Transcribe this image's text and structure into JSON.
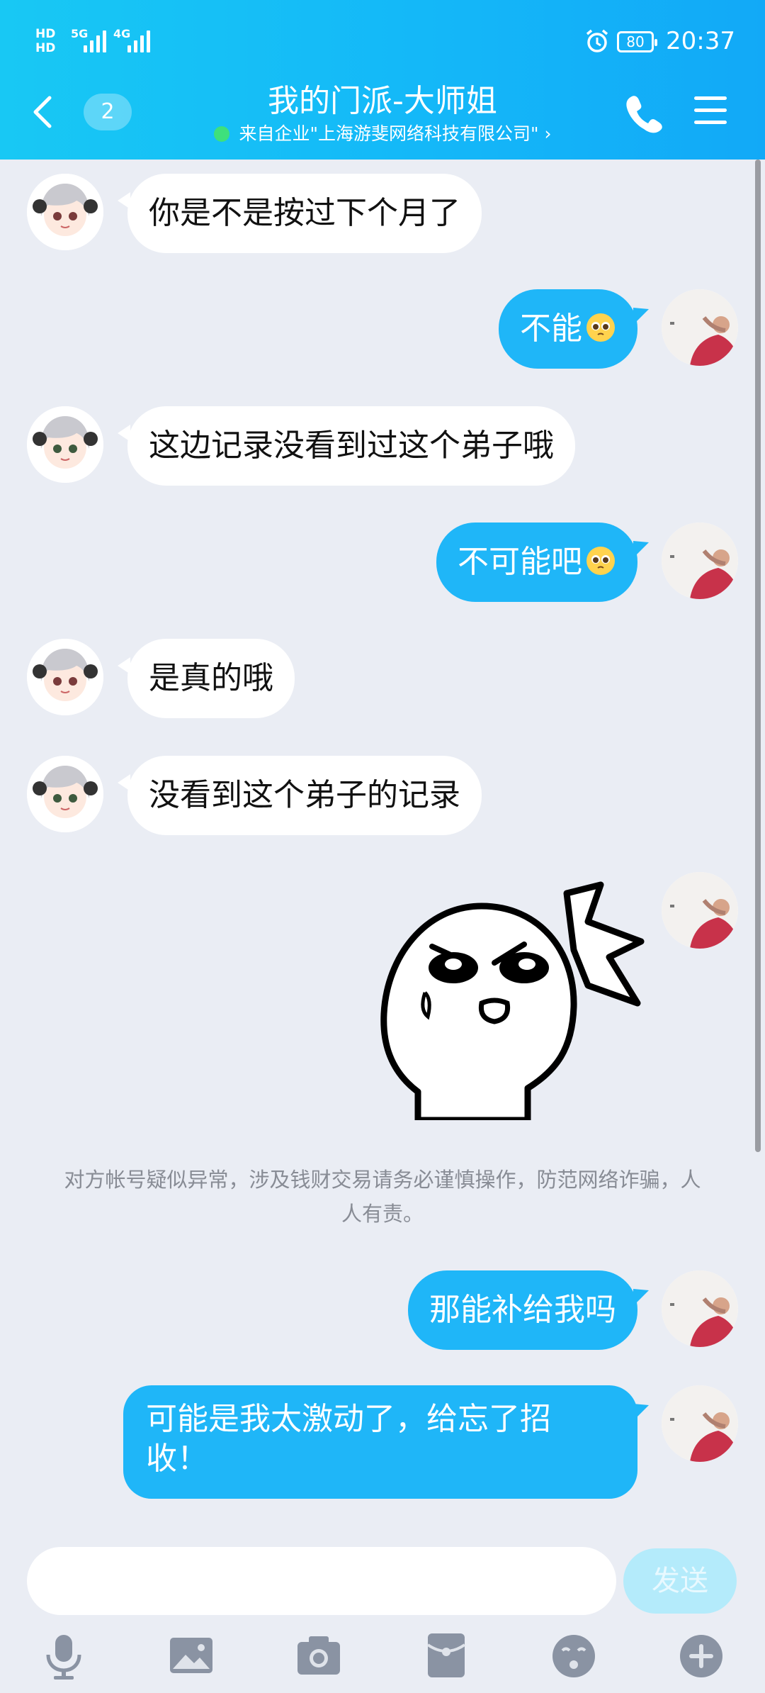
{
  "status_bar": {
    "network_left": "HD",
    "network_5g": "5G",
    "network_4g": "4G",
    "battery": "80",
    "time": "20:37"
  },
  "header": {
    "unread_count": "2",
    "title": "我的门派-大师姐",
    "subtitle": "来自企业\"上海游斐网络科技有限公司\" ›"
  },
  "messages": [
    {
      "side": "left",
      "text": "你是不是按过下个月了"
    },
    {
      "side": "right",
      "text": "不能"
    },
    {
      "side": "left",
      "text": "这边记录没看到过这个弟子哦"
    },
    {
      "side": "right",
      "text": "不可能吧"
    },
    {
      "side": "left",
      "text": "是真的哦"
    },
    {
      "side": "left",
      "text": "没看到这个弟子的记录"
    },
    {
      "side": "right",
      "text": "[sticker]"
    },
    {
      "side": "right",
      "text": "那能补给我吗"
    },
    {
      "side": "right",
      "text": "可能是我太激动了，给忘了招\n收！"
    }
  ],
  "notice": "对方帐号疑似异常，涉及钱财交易请务必谨慎操作，防范网络诈骗，人人有责。",
  "input": {
    "value": "",
    "placeholder": ""
  },
  "send_label": "发送",
  "toolbar_icons": [
    "microphone-icon",
    "image-icon",
    "camera-icon",
    "red-packet-icon",
    "emoji-icon",
    "plus-icon"
  ],
  "colors": {
    "header": "#14b8f8",
    "bubble_right": "#1fb6f8",
    "bubble_left": "#ffffff",
    "background": "#eaedf4"
  }
}
